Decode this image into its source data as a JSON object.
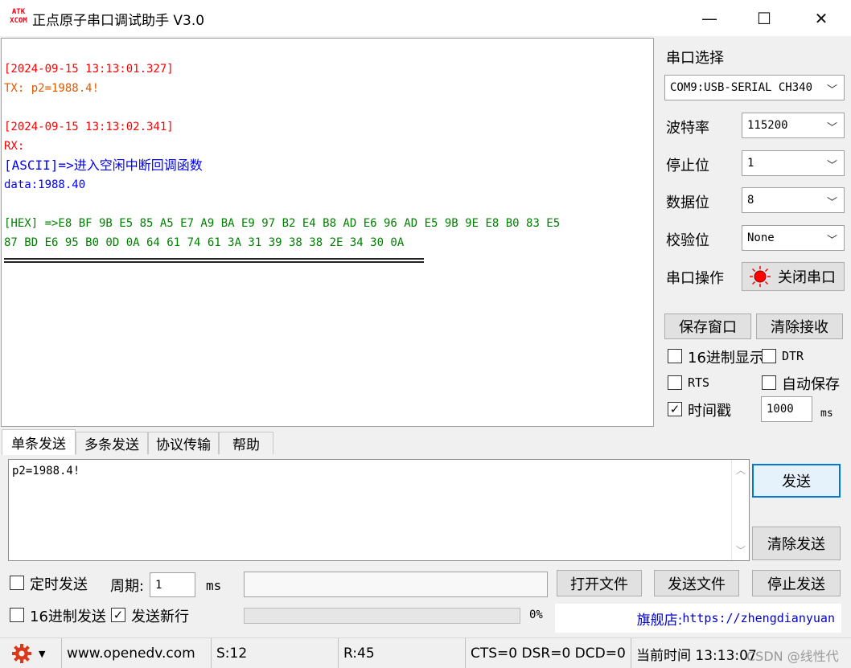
{
  "window": {
    "logo_text": "ATK\nXCOM",
    "title": "正点原子串口调试助手 V3.0",
    "minimize": "—",
    "maximize": "☐",
    "close": "✕"
  },
  "receive": {
    "lines": [
      "[2024-09-15 13:13:01.327]",
      "TX: p2=1988.4!",
      "[2024-09-15 13:13:02.341]",
      "RX:",
      "[ASCII]=>进入空闲中断回调函数",
      "data:1988.40",
      "[HEX]  =>E8 BF 9B E5 85 A5 E7 A9 BA E9 97 B2 E4 B8 AD E6 96 AD E5 9B 9E E8 B0 83 E5",
      "87 BD E6 95 B0 0D 0A 64 61 74 61 3A 31 39 38 38 2E 34 30 0A"
    ],
    "colors": {
      "timestamp": "#ff0000",
      "tx": "#e05a00",
      "ascii": "#0000ff",
      "hex": "#008000"
    }
  },
  "panel": {
    "port_select_label": "串口选择",
    "port_value": "COM9:USB-SERIAL CH340",
    "baud_label": "波特率",
    "baud_value": "115200",
    "stopbits_label": "停止位",
    "stopbits_value": "1",
    "databits_label": "数据位",
    "databits_value": "8",
    "parity_label": "校验位",
    "parity_value": "None",
    "port_op_label": "串口操作",
    "close_port_button": "关闭串口",
    "save_window_button": "保存窗口",
    "clear_receive_button": "清除接收",
    "hex_display_label": "16进制显示",
    "hex_display_checked": false,
    "dtr_label": "DTR",
    "dtr_checked": false,
    "rts_label": "RTS",
    "rts_checked": false,
    "autosave_label": "自动保存",
    "autosave_checked": false,
    "timestamp_label": "时间戳",
    "timestamp_checked": true,
    "timestamp_interval": "1000",
    "timestamp_unit": "ms"
  },
  "tabs": [
    "单条发送",
    "多条发送",
    "协议传输",
    "帮助"
  ],
  "send": {
    "text": "p2=1988.4!",
    "send_button": "发送",
    "clear_send_button": "清除发送",
    "timed_send_label": "定时发送",
    "timed_send_checked": false,
    "period_label": "周期:",
    "period_value": "1",
    "period_unit": "ms",
    "file_path": "",
    "open_file_button": "打开文件",
    "send_file_button": "发送文件",
    "stop_send_button": "停止发送",
    "hex_send_label": "16进制发送",
    "hex_send_checked": false,
    "newline_label": "发送新行",
    "newline_checked": true,
    "progress_text": "0%",
    "progress": 0,
    "store_label": "旗舰店:",
    "store_url": "https://zhengdianyuan"
  },
  "status": {
    "website": "www.openedv.com",
    "sent": "S:12",
    "received": "R:45",
    "lines": "CTS=0 DSR=0 DCD=0",
    "time": "当前时间 13:13:07",
    "watermark": "CSDN @线性代"
  }
}
